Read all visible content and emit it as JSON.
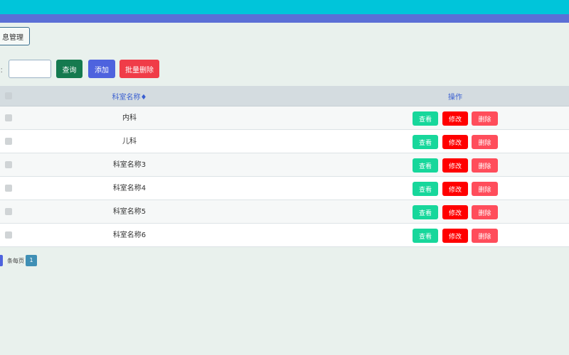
{
  "colors": {
    "topbar": "#00c5da",
    "subbar": "#5b6fd6",
    "view_button": "#17d79b",
    "edit_button": "#ff0000",
    "delete_button": "#ff4d5b"
  },
  "breadcrumb": {
    "label": "息管理"
  },
  "toolbar": {
    "search_label": "：",
    "search_value": "",
    "query_label": "查询",
    "add_label": "添加",
    "batch_delete_label": "批量删除"
  },
  "table": {
    "columns": {
      "name": "科室名称♦",
      "actions": "操作"
    },
    "action_labels": {
      "view": "查看",
      "edit": "修改",
      "delete": "删除"
    },
    "rows": [
      {
        "name": "内科"
      },
      {
        "name": "儿科"
      },
      {
        "name": "科室名称3"
      },
      {
        "name": "科室名称4"
      },
      {
        "name": "科室名称5"
      },
      {
        "name": "科室名称6"
      }
    ]
  },
  "pagination": {
    "per_page_text": "条每页",
    "current_page": "1"
  }
}
